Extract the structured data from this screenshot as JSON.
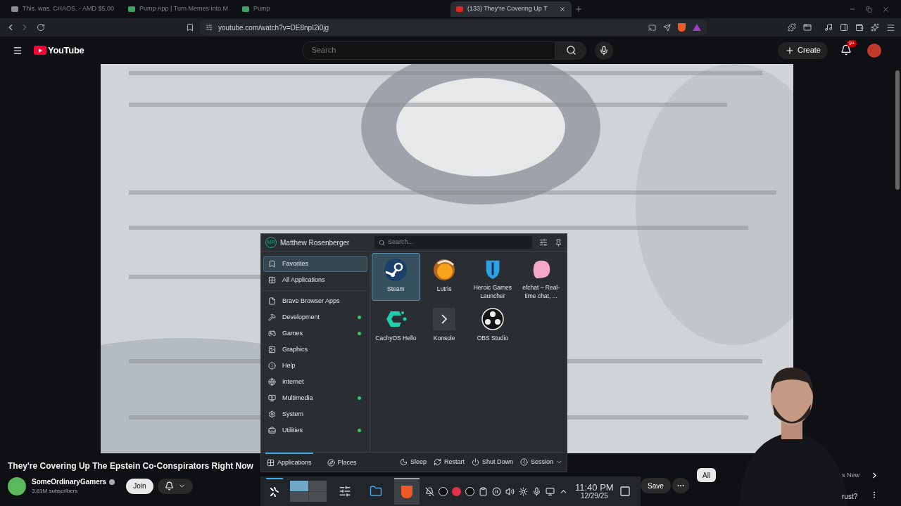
{
  "browser": {
    "tabs": [
      {
        "title": "This. was. CHAOS. - AMD $5,00",
        "selected": false
      },
      {
        "title": "Pump App | Turn Memes into M",
        "selected": false
      },
      {
        "title": "Pump",
        "selected": false
      },
      {
        "title": "(133) They’re Covering Up T",
        "selected": true
      }
    ],
    "url": "youtube.com/watch?v=DE8npI2i0jg"
  },
  "youtube": {
    "logo": "YouTube",
    "search_placeholder": "Search",
    "create": "Create",
    "notifications": "9+",
    "video": {
      "kind": "picture",
      "title": "They're Covering Up The Epstein Co-Conspirators Right Now",
      "channel": "SomeOrdinaryGamers",
      "subscribers": "3.81M subscribers",
      "join": "Join",
      "save": "Save"
    },
    "chip": "All",
    "chip_partial": "s New",
    "sidebar_partial": "rust?"
  },
  "launcher": {
    "user": "Matthew Rosenberger",
    "initials": "MR",
    "search_placeholder": "Search...",
    "categories": [
      {
        "label": "Favorites",
        "selected": true,
        "new": false
      },
      {
        "label": "All Applications",
        "selected": false,
        "new": false
      },
      {
        "label": "Brave Browser Apps",
        "selected": false,
        "new": false
      },
      {
        "label": "Development",
        "selected": false,
        "new": true
      },
      {
        "label": "Games",
        "selected": false,
        "new": true
      },
      {
        "label": "Graphics",
        "selected": false,
        "new": false
      },
      {
        "label": "Help",
        "selected": false,
        "new": false
      },
      {
        "label": "Internet",
        "selected": false,
        "new": false
      },
      {
        "label": "Multimedia",
        "selected": false,
        "new": true
      },
      {
        "label": "System",
        "selected": false,
        "new": false
      },
      {
        "label": "Utilities",
        "selected": false,
        "new": true
      }
    ],
    "apps": [
      {
        "name": "Steam",
        "selected": true
      },
      {
        "name": "Lutris",
        "selected": false
      },
      {
        "name": "Heroic Games Launcher",
        "selected": false
      },
      {
        "name": "efchat – Real-time chat, ...",
        "selected": false
      },
      {
        "name": "CachyOS Hello",
        "selected": false
      },
      {
        "name": "Konsole",
        "selected": false
      },
      {
        "name": "OBS Studio",
        "selected": false
      }
    ],
    "tabs": [
      {
        "label": "Applications",
        "selected": true
      },
      {
        "label": "Places",
        "selected": false
      }
    ],
    "actions": [
      "Sleep",
      "Restart",
      "Shut Down",
      "Session"
    ]
  },
  "taskbar": {
    "tasks": [
      {
        "selected": false
      },
      {
        "selected": false
      },
      {
        "selected": true
      }
    ],
    "time": "11:40 PM",
    "date": "12/29/25"
  }
}
